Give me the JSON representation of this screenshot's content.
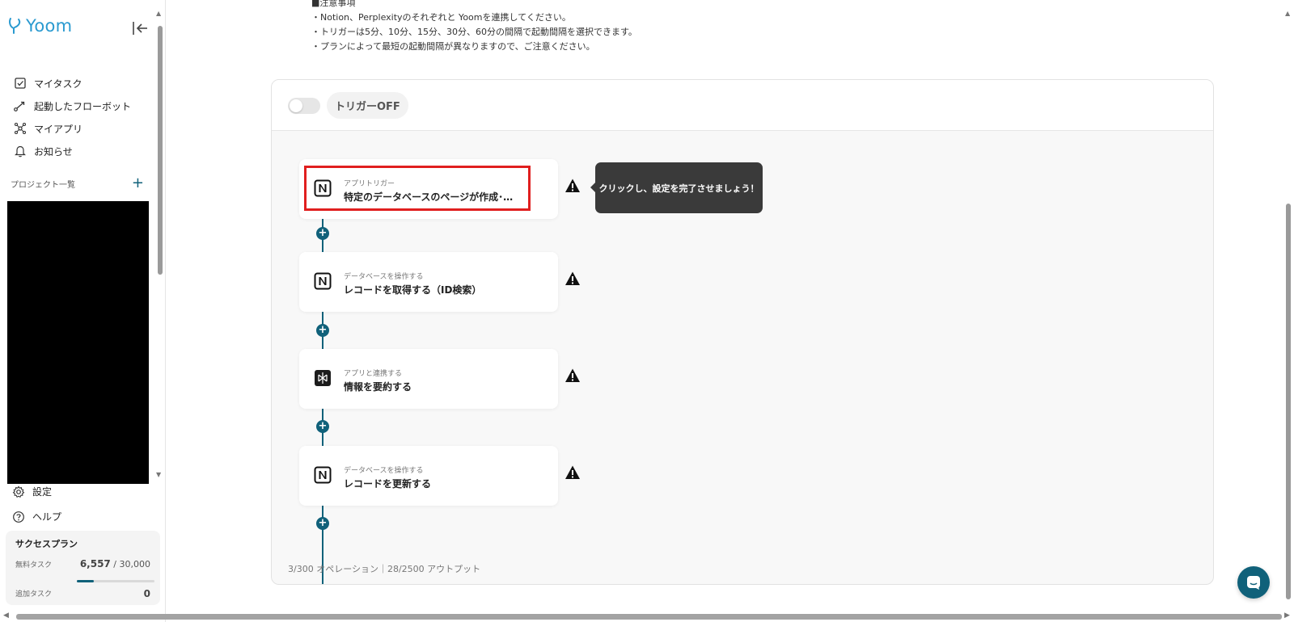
{
  "app": {
    "logo_text": "Yoom"
  },
  "sidebar": {
    "nav": [
      {
        "label": "マイタスク",
        "icon": "checkbox-icon"
      },
      {
        "label": "起動したフローボット",
        "icon": "route-icon"
      },
      {
        "label": "マイアプリ",
        "icon": "apps-network-icon"
      },
      {
        "label": "お知らせ",
        "icon": "bell-icon"
      }
    ],
    "projects_label": "プロジェクト一覧",
    "projects_add": "+",
    "bottom_nav": [
      {
        "label": "設定",
        "icon": "gear-icon"
      },
      {
        "label": "ヘルプ",
        "icon": "help-circle-icon"
      }
    ],
    "plan": {
      "title": "サクセスプラン",
      "free_task_label": "無料タスク",
      "free_task_used": "6,557",
      "free_task_total": " / 30,000",
      "free_task_ratio": 0.2186,
      "extra_task_label": "追加タスク",
      "extra_task_value": "0"
    }
  },
  "notes": {
    "lines": [
      "■注意事項",
      "・Notion、Perplexityのそれぞれと Yoomを連携してください。",
      "・トリガーは5分、10分、15分、30分、60分の間隔で起動間隔を選択できます。",
      "・プランによって最短の起動間隔が異なりますので、ご注意ください。"
    ]
  },
  "flow": {
    "toggle_state": "off",
    "trigger_label": "トリガーOFF",
    "plus": "+",
    "steps": [
      {
        "sub": "アプリトリガー",
        "title": "特定のデータベースのページが作成･…",
        "icon": "notion-icon",
        "highlighted": true
      },
      {
        "sub": "データベースを操作する",
        "title": "レコードを取得する（ID検索）",
        "icon": "notion-icon",
        "highlighted": false
      },
      {
        "sub": "アプリと連携する",
        "title": "情報を要約する",
        "icon": "perplexity-icon",
        "highlighted": false
      },
      {
        "sub": "データベースを操作する",
        "title": "レコードを更新する",
        "icon": "notion-icon",
        "highlighted": false
      }
    ],
    "tooltip": "クリックし、設定を完了させましょう！",
    "footer": "3/300 オペレーション｜28/2500 アウトプット"
  },
  "colors": {
    "accent": "#10617a",
    "logo": "#2a9ad0",
    "highlight": "#e01f1f",
    "tooltip_bg": "#3a3a3a"
  }
}
